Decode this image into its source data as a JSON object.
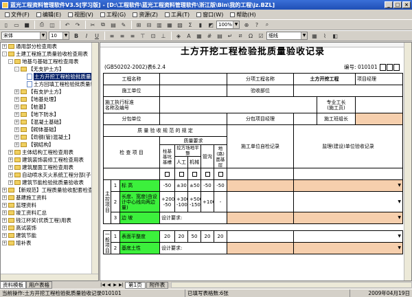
{
  "window": {
    "title": "蓝光工程资料管理软件V3.5[学习版] - [D:\\工程软件\\蓝光工程资料管理软件\\浙江版\\Bin\\我的工程\\jz.BZL]"
  },
  "menu": [
    "文件(F)",
    "编辑(E)",
    "视图(V)",
    "工程(G)",
    "资源(Z)",
    "工具(T)",
    "窗口(W)",
    "帮助(H)"
  ],
  "toolbar": {
    "zoom": "100%",
    "font": "宋体",
    "font_size": "10",
    "border_style": "细线",
    "bold": "B",
    "italic": "I",
    "underline": "U"
  },
  "tree": [
    {
      "label": "通用部分检查用表",
      "level": 0,
      "expander": "+",
      "icon": "folder"
    },
    {
      "label": "土建工程施工质量验收检查用表",
      "level": 0,
      "expander": "-",
      "icon": "folder"
    },
    {
      "label": "地基与基础工程检查用表",
      "level": 1,
      "expander": "-",
      "icon": "folder"
    },
    {
      "label": "【无支护土方】",
      "level": 2,
      "expander": "-",
      "icon": "folder"
    },
    {
      "label": "土方开挖工程检验批质量验",
      "level": 3,
      "expander": "",
      "icon": "doc",
      "selected": true
    },
    {
      "label": "土方回填工程检验批质量验",
      "level": 3,
      "expander": "",
      "icon": "doc"
    },
    {
      "label": "【有支护土方】",
      "level": 2,
      "expander": "+",
      "icon": "folder"
    },
    {
      "label": "【地基处理】",
      "level": 2,
      "expander": "+",
      "icon": "folder"
    },
    {
      "label": "【桩基】",
      "level": 2,
      "expander": "+",
      "icon": "folder"
    },
    {
      "label": "【地下防水】",
      "level": 2,
      "expander": "+",
      "icon": "folder"
    },
    {
      "label": "【混凝土基础】",
      "level": 2,
      "expander": "+",
      "icon": "folder"
    },
    {
      "label": "【砌体基础】",
      "level": 2,
      "expander": "+",
      "icon": "folder"
    },
    {
      "label": "【劲钢(管)混凝土】",
      "level": 2,
      "expander": "+",
      "icon": "folder"
    },
    {
      "label": "【钢结构】",
      "level": 2,
      "expander": "+",
      "icon": "folder"
    },
    {
      "label": "主体结构工程检查用表",
      "level": 1,
      "expander": "+",
      "icon": "folder"
    },
    {
      "label": "建筑装饰装修工程检查用表",
      "level": 1,
      "expander": "+",
      "icon": "folder"
    },
    {
      "label": "建筑屋面工程检查用表",
      "level": 1,
      "expander": "+",
      "icon": "folder"
    },
    {
      "label": "自动喷水灭火系统工程分部(子分",
      "level": 1,
      "expander": "+",
      "icon": "folder"
    },
    {
      "label": "建筑节能检验批质量验收表",
      "level": 1,
      "expander": "+",
      "icon": "folder"
    },
    {
      "label": "【新规范】工程质量验收配套检查用",
      "level": 0,
      "expander": "+",
      "icon": "folder"
    },
    {
      "label": "基建施工资料",
      "level": 0,
      "expander": "+",
      "icon": "folder"
    },
    {
      "label": "监理资料",
      "level": 0,
      "expander": "+",
      "icon": "folder"
    },
    {
      "label": "竣工资料汇总",
      "level": 0,
      "expander": "+",
      "icon": "folder"
    },
    {
      "label": "钱江杯奖(优质工程)用表",
      "level": 0,
      "expander": "+",
      "icon": "folder"
    },
    {
      "label": "高试装饰",
      "level": 0,
      "expander": "+",
      "icon": "folder"
    },
    {
      "label": "建筑节能",
      "level": 0,
      "expander": "+",
      "icon": "folder"
    },
    {
      "label": "增补表",
      "level": 0,
      "expander": "+",
      "icon": "folder"
    }
  ],
  "side_tabs": [
    "资料模板",
    "用户表格"
  ],
  "form": {
    "title": "土方开挖工程检验批质量验收记录",
    "standard": "(GB50202-2002)表6.2.4",
    "number_label": "编号:",
    "number_value": "010101",
    "labels": {
      "project_name": "工程名称",
      "subproject_name": "分项工程名称",
      "subproject_value": "土方开挖工程",
      "project_manager": "项目经理",
      "construction_unit": "施工单位",
      "acceptance_part": "验收部位",
      "exec_standard": "施工执行标准",
      "exec_standard2": "名称及编号",
      "pro_foreman": "专业工长",
      "pro_foreman2": "(施工员)",
      "sub_unit": "分包单位",
      "sub_manager": "分包项目经理",
      "team_leader": "施工班组长",
      "quality_spec": "质 量 验 收 规 范 的 规 定",
      "check_items": "检 查 项 目",
      "quality_req": "质量要求",
      "pile_base1": "柱基基坑基槽",
      "excav_area1": "挖方场地平整",
      "manual": "人工",
      "machine": "机械",
      "pipe_trench": "管沟",
      "surface1": "地(路)面基层",
      "self_check": "施工单位自检记录",
      "supervisor_check": "监理(建设)单位验收记录",
      "main_control": "主控项目",
      "general": "一般项目",
      "design_req": "设计要求:"
    },
    "rows": [
      {
        "no": "1",
        "item": "标  高",
        "v": [
          "-50",
          "±30",
          "±50",
          "-50",
          "-50"
        ]
      },
      {
        "no": "2",
        "item": "长度、宽度(由设计中心线向两边量)",
        "v": [
          "+200 -50",
          "+300 -100",
          "+500 -150",
          "+100",
          "-"
        ]
      },
      {
        "no": "3",
        "item": "边  坡",
        "v": []
      },
      {
        "no": "1",
        "item": "表面平整度",
        "v": [
          "20",
          "20",
          "50",
          "20",
          "20"
        ]
      },
      {
        "no": "2",
        "item": "基底土性",
        "v": []
      }
    ]
  },
  "sheet_tabs": [
    "第1页",
    "附件表"
  ],
  "status": {
    "current_table": "当前操作:土方开挖工程检验批质量验收记录010101",
    "fill_count": "已填写表格数:6张",
    "date": "2009年04月19日"
  }
}
